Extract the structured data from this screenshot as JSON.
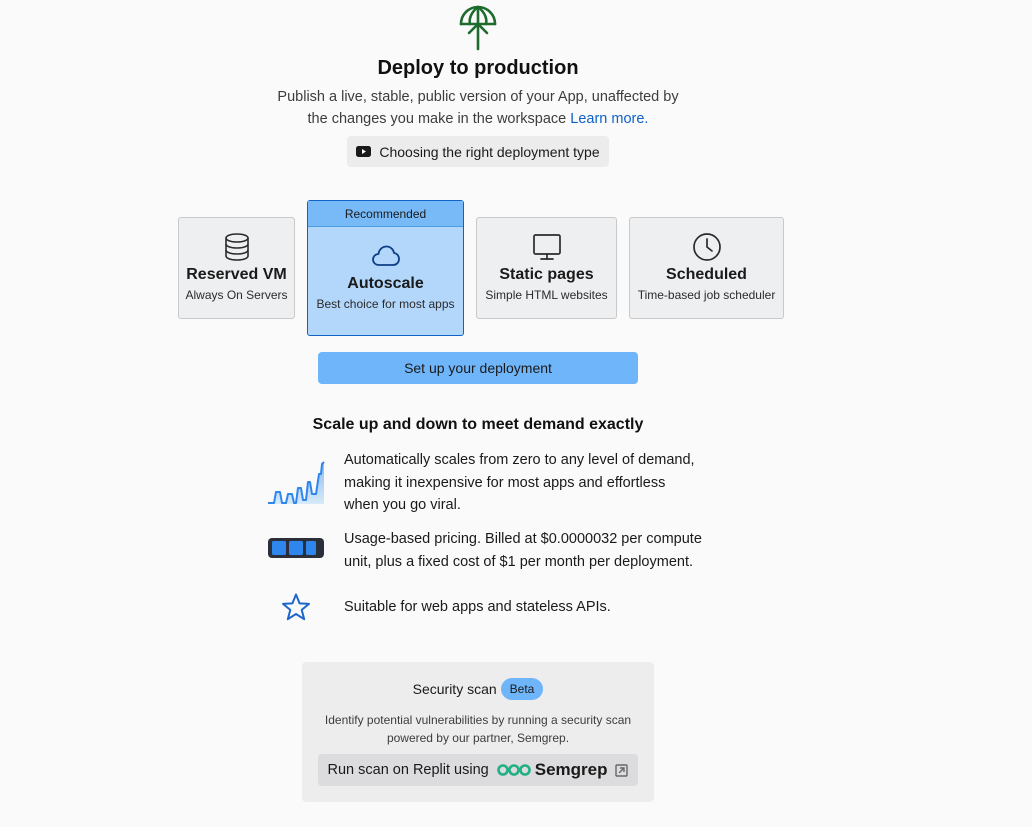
{
  "hero": {
    "icon": "deploy-globe-arrow-icon",
    "title": "Deploy to production",
    "subtitle_line1": "Publish a live, stable, public version of your App, unaffected by",
    "subtitle_line2": "the changes you make in the workspace",
    "learn_more": "Learn more.",
    "video_label": "Choosing the right deployment type"
  },
  "deployment_types": [
    {
      "name": "Reserved VM",
      "desc": "Always On Servers",
      "icon": "database-icon"
    },
    {
      "name": "Autoscale",
      "desc": "Best choice for most apps",
      "icon": "cloud-icon",
      "badge": "Recommended",
      "selected": true
    },
    {
      "name": "Static pages",
      "desc": "Simple HTML websites",
      "icon": "monitor-icon"
    },
    {
      "name": "Scheduled",
      "desc": "Time-based job scheduler",
      "icon": "clock-icon"
    }
  ],
  "setup_button": "Set up your deployment",
  "details": {
    "title": "Scale up and down to meet demand exactly",
    "features": [
      {
        "icon": "scaling-graph-icon",
        "line1": "Automatically scales from zero to any level of demand,",
        "line2": "making it inexpensive for most apps and effortless",
        "line3": "when you go viral."
      },
      {
        "icon": "battery-icon",
        "line1": "Usage-based pricing. Billed at $0.0000032 per compute",
        "line2": "unit, plus a fixed cost of $1 per month per deployment."
      },
      {
        "icon": "star-icon",
        "line1": "Suitable for web apps and stateless APIs."
      }
    ]
  },
  "security": {
    "title": "Security scan",
    "badge": "Beta",
    "desc_line1": "Identify potential vulnerabilities by running a security scan",
    "desc_line2": "powered by our partner, Semgrep.",
    "scan_button": "Run scan on Replit using",
    "partner": "Semgrep"
  },
  "colors": {
    "accent": "#0f62c9",
    "selected_card": "#b3d6fb",
    "button": "#6fb5fa",
    "hero_icon": "#1e6b2e",
    "semgrep": "#21b084"
  }
}
